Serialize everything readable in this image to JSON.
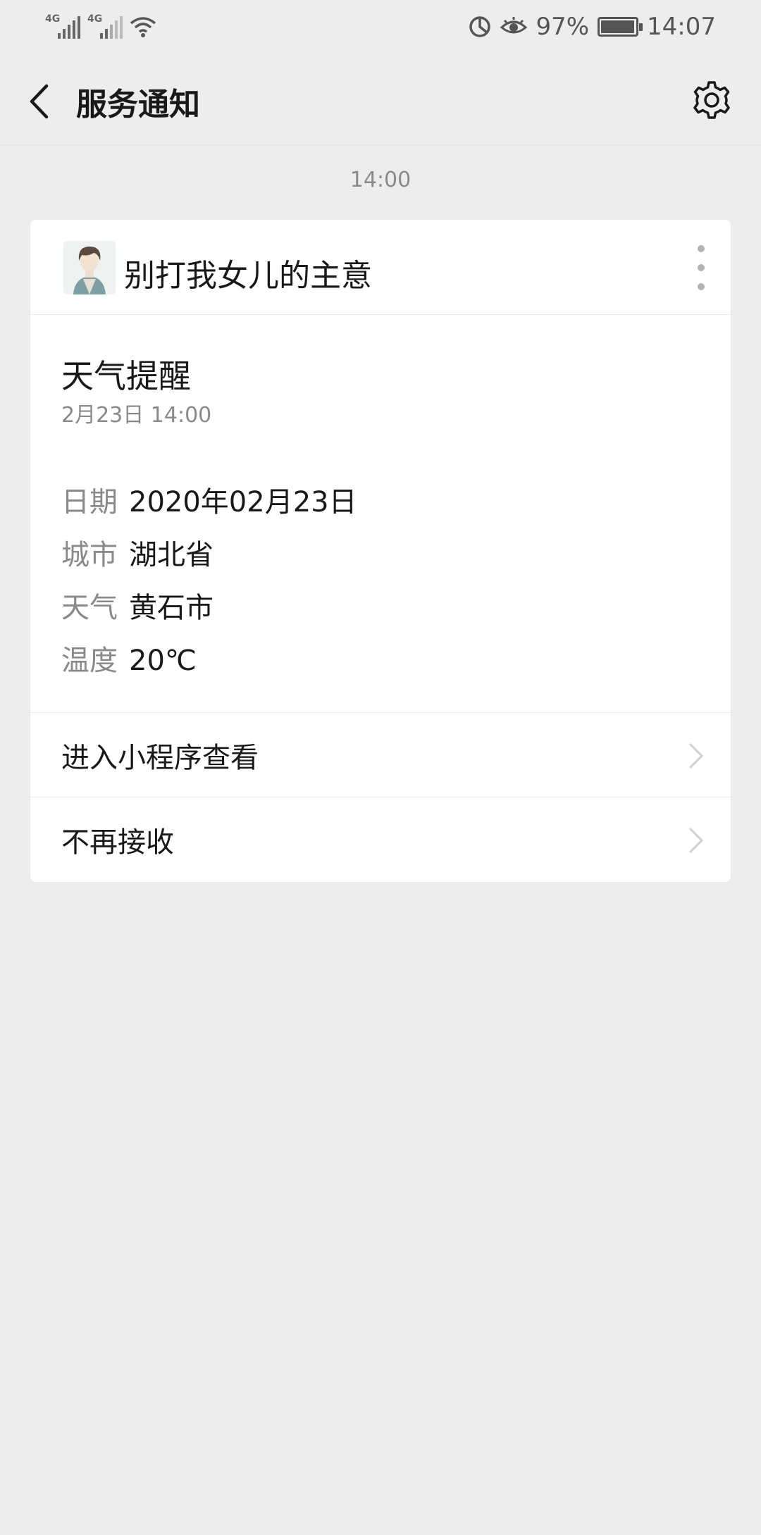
{
  "status_bar": {
    "signal1_label": "4G",
    "signal2_label": "4G",
    "battery_percent": "97%",
    "battery_level": 0.97,
    "time": "14:07",
    "icons": [
      "signal-icon",
      "signal-icon",
      "wifi-icon",
      "data-saver-icon",
      "eye-care-icon",
      "battery-icon"
    ]
  },
  "nav": {
    "title": "服务通知",
    "back_icon": "back-arrow-icon",
    "settings_icon": "gear-icon"
  },
  "message_time": "14:00",
  "card": {
    "sender": "别打我女儿的主意",
    "title": "天气提醒",
    "date": "2月23日  14:00",
    "fields": [
      {
        "key": "日期",
        "value": "2020年02月23日"
      },
      {
        "key": "城市",
        "value": "湖北省"
      },
      {
        "key": "天气",
        "value": "黄石市"
      },
      {
        "key": "温度",
        "value": "20℃"
      }
    ],
    "actions": [
      {
        "label": "进入小程序查看"
      },
      {
        "label": "不再接收"
      }
    ]
  },
  "colors": {
    "background": "#ededed",
    "card": "#ffffff",
    "primary_text": "#191919",
    "secondary_text": "#8a8a8a"
  }
}
